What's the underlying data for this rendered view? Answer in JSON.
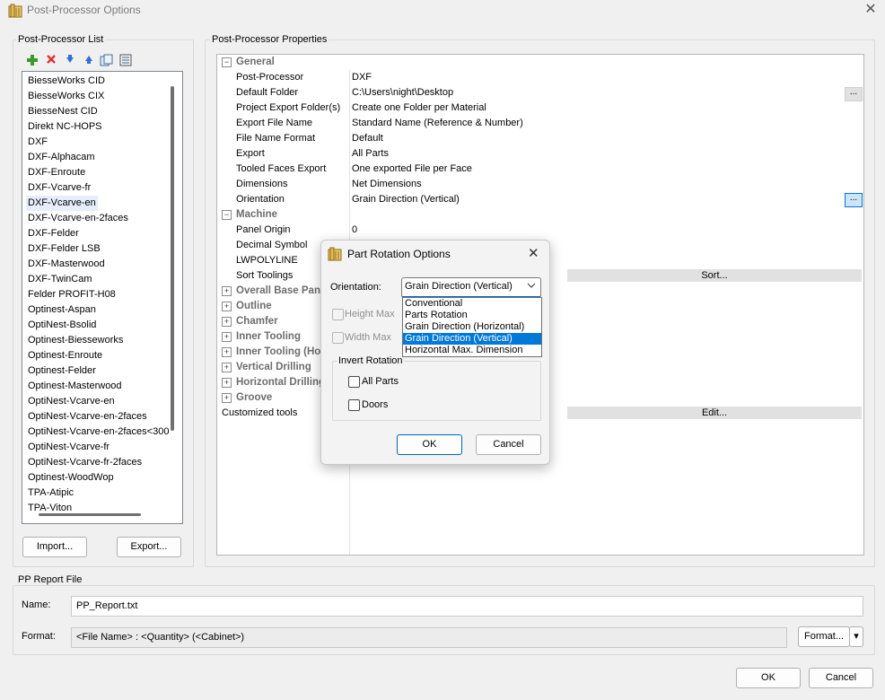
{
  "window": {
    "title": "Post-Processor Options",
    "close_glyph": "✕",
    "icon": "post-processor-app-icon"
  },
  "pp_list": {
    "group_label": "Post-Processor List",
    "toolbar_icons": [
      "add-icon",
      "delete-icon",
      "move-down-icon",
      "move-up-icon",
      "copy-icon",
      "properties-icon"
    ],
    "items": [
      "BiesseWorks CID",
      "BiesseWorks CIX",
      "BiesseNest CID",
      "Direkt NC-HOPS",
      "DXF",
      "DXF-Alphacam",
      "DXF-Enroute",
      "DXF-Vcarve-fr",
      "DXF-Vcarve-en",
      "DXF-Vcarve-en-2faces",
      "DXF-Felder",
      "DXF-Felder LSB",
      "DXF-Masterwood",
      "DXF-TwinCam",
      "Felder PROFIT-H08",
      "Optinest-Aspan",
      "OptiNest-Bsolid",
      "Optinest-Biesseworks",
      "Optinest-Enroute",
      "Optinest-Felder",
      "Optinest-Masterwood",
      "OptiNest-Vcarve-en",
      "OptiNest-Vcarve-en-2faces",
      "OptiNest-Vcarve-en-2faces<300",
      "OptiNest-Vcarve-fr",
      "OptiNest-Vcarve-fr-2faces",
      "Optinest-WoodWop",
      "TPA-Atipic",
      "TPA-Viton"
    ],
    "selected_index": 8,
    "import_label": "Import...",
    "export_label": "Export..."
  },
  "properties": {
    "group_label": "Post-Processor Properties",
    "general_label": "General",
    "general_rows": [
      {
        "name": "Post-Processor",
        "value": "DXF"
      },
      {
        "name": "Default Folder",
        "value": "C:\\Users\\night\\Desktop"
      },
      {
        "name": "Project Export Folder(s)",
        "value": "Create one Folder per Material"
      },
      {
        "name": "Export File Name",
        "value": "Standard Name (Reference & Number)"
      },
      {
        "name": "File Name Format",
        "value": "Default"
      },
      {
        "name": "Export",
        "value": "All Parts"
      },
      {
        "name": "Tooled Faces Export",
        "value": "One exported File per Face"
      },
      {
        "name": "Dimensions",
        "value": "Net Dimensions"
      },
      {
        "name": "Orientation",
        "value": "Grain Direction (Vertical)"
      }
    ],
    "machine_label": "Machine",
    "machine_rows": [
      {
        "name": "Panel Origin",
        "value": "0"
      },
      {
        "name": "Decimal Symbol",
        "value": ""
      },
      {
        "name": "LWPOLYLINE",
        "value": ""
      },
      {
        "name": "Sort Toolings",
        "value": ""
      }
    ],
    "sort_button": "Sort...",
    "collapsed_categories": [
      "Overall Base Panel",
      "Outline",
      "Chamfer",
      "Inner Tooling",
      "Inner Tooling (Horizontal)",
      "Vertical Drilling",
      "Horizontal Drilling",
      "Groove"
    ],
    "customized_tools_label": "Customized tools",
    "edit_button": "Edit...",
    "ellipsis": "..."
  },
  "report": {
    "group_label": "PP Report File",
    "name_label": "Name:",
    "name_value": "PP_Report.txt",
    "format_label": "Format:",
    "format_value": "<File Name> : <Quantity> (<Cabinet>)",
    "format_button": "Format...",
    "format_arrow": "▾"
  },
  "footer": {
    "ok": "OK",
    "cancel": "Cancel"
  },
  "dialog": {
    "title": "Part Rotation Options",
    "close_glyph": "✕",
    "orientation_label": "Orientation:",
    "orientation_value": "Grain Direction (Vertical)",
    "options": [
      "Conventional",
      "Parts Rotation",
      "Grain Direction (Horizontal)",
      "Grain Direction (Vertical)",
      "Horizontal Max. Dimension"
    ],
    "selected_option_index": 3,
    "height_max_label": "Height Max",
    "width_max_label": "Width Max",
    "invert_rotation_label": "Invert Rotation",
    "all_parts_label": "All Parts",
    "doors_label": "Doors",
    "ok": "OK",
    "cancel": "Cancel"
  },
  "colors": {
    "selection": "#0078d7",
    "window_bg": "#f0f0f0",
    "category_text": "#6d6d6d"
  }
}
